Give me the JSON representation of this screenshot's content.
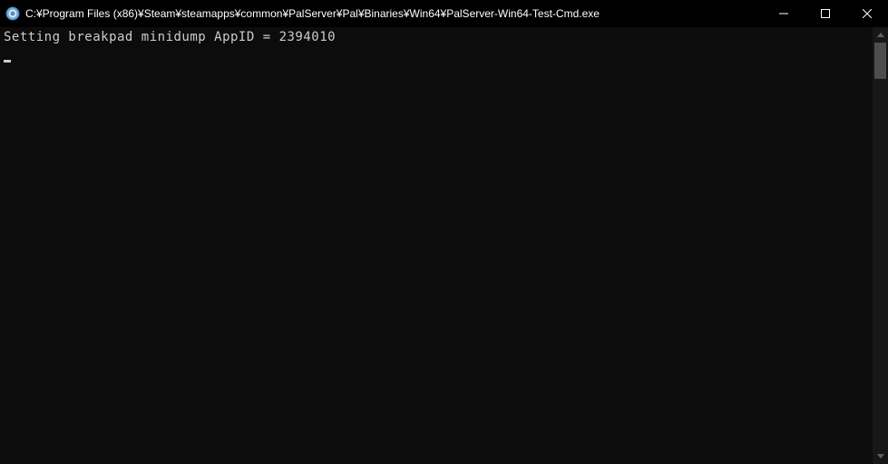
{
  "window": {
    "title": "C:¥Program Files (x86)¥Steam¥steamapps¥common¥PalServer¥Pal¥Binaries¥Win64¥PalServer-Win64-Test-Cmd.exe"
  },
  "console": {
    "lines": [
      "Setting breakpad minidump AppID = 2394010"
    ]
  }
}
